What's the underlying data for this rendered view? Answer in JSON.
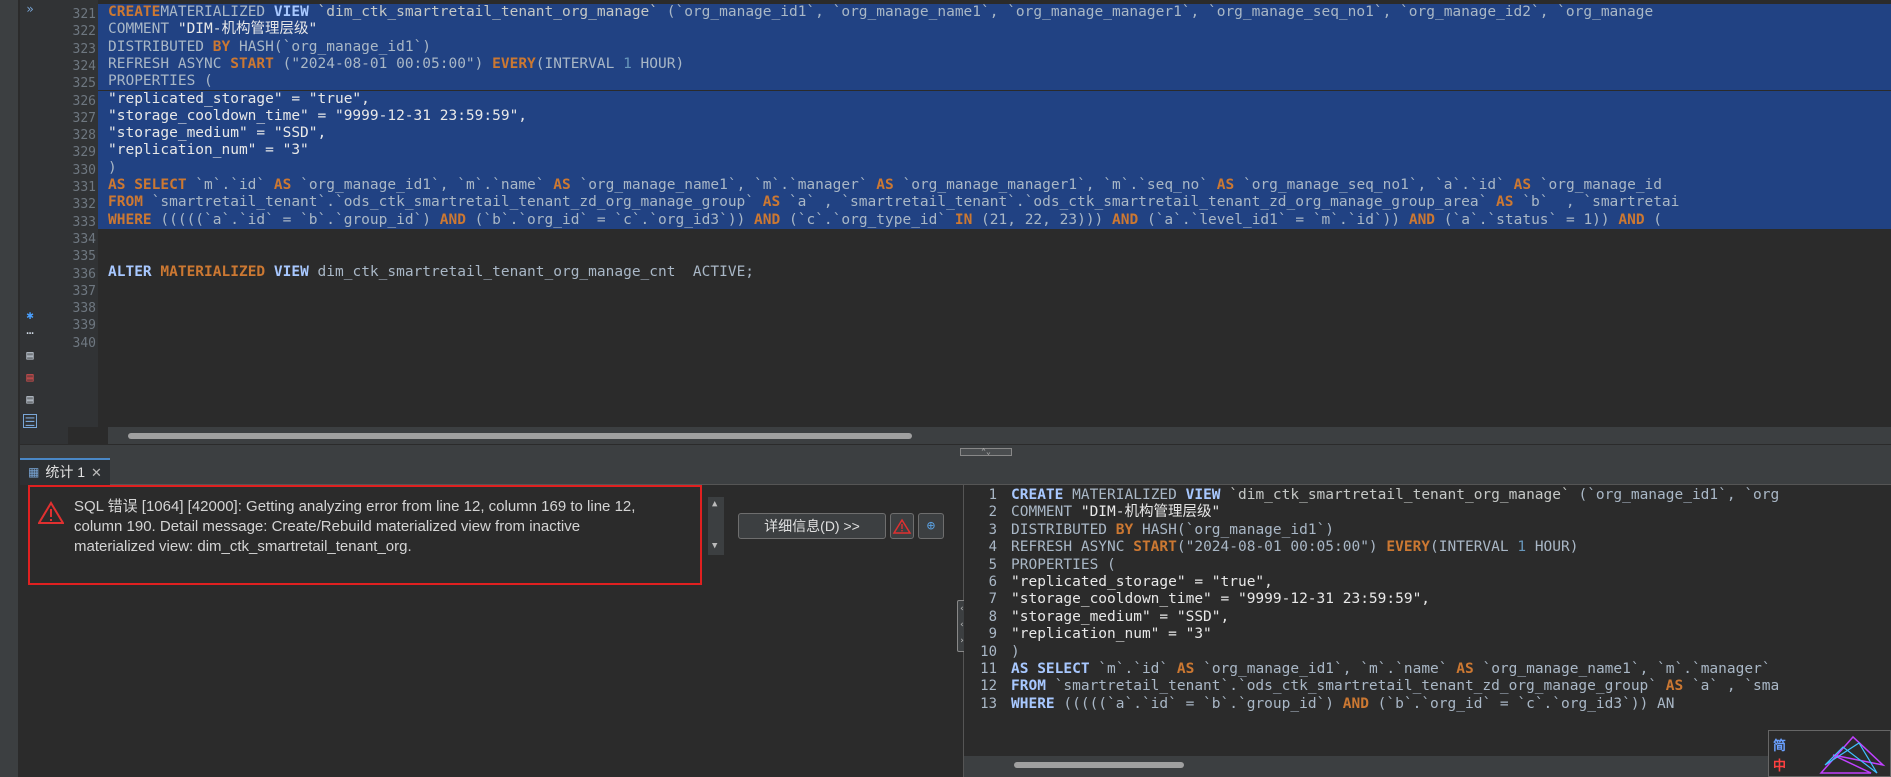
{
  "editor": {
    "line_numbers": [
      "321",
      "322",
      "323",
      "324",
      "325",
      "326",
      "327",
      "328",
      "329",
      "330",
      "331",
      "332",
      "333",
      "334",
      "335",
      "336",
      "337",
      "338",
      "339",
      "340"
    ],
    "lines": [
      {
        "parts": [
          [
            "kw",
            "CREATE"
          ],
          [
            "",
            "MATERIALIZED"
          ],
          [
            "kb",
            " VIEW"
          ],
          [
            "bt",
            " `dim_ctk_smartretail_tenant_org_manage`"
          ],
          [
            "",
            " (`org_manage_id1`, `org_manage_name1`, `org_manage_manager1`, `org_manage_seq_no1`, `org_manage_id2`, `org_manage"
          ]
        ],
        "sel": true
      },
      {
        "parts": [
          [
            "",
            "COMMENT "
          ],
          [
            "str",
            "\"DIM-机构管理层级\""
          ]
        ],
        "sel": true
      },
      {
        "parts": [
          [
            "",
            "DISTRIBUTED "
          ],
          [
            "kw",
            "BY"
          ],
          [
            "",
            " HASH(`org_manage_id1`)"
          ]
        ],
        "sel": true
      },
      {
        "parts": [
          [
            "",
            "REFRESH ASYNC "
          ],
          [
            "kw",
            "START"
          ],
          [
            "",
            " (\"2024-08-01 00:05:00\") "
          ],
          [
            "kw",
            "EVERY"
          ],
          [
            "",
            "(INTERVAL "
          ],
          [
            "num",
            "1"
          ],
          [
            "",
            " HOUR)"
          ]
        ],
        "sel": true
      },
      {
        "parts": [
          [
            "",
            "PROPERTIES ("
          ]
        ],
        "sel": true
      },
      {
        "parts": [
          [
            "str",
            "\"replicated_storage\" = \"true\","
          ]
        ],
        "sel": true
      },
      {
        "parts": [
          [
            "str",
            "\"storage_cooldown_time\" = \"9999-12-31 23:59:59\","
          ]
        ],
        "sel": true
      },
      {
        "parts": [
          [
            "str",
            "\"storage_medium\" = \"SSD\","
          ]
        ],
        "sel": true
      },
      {
        "parts": [
          [
            "str",
            "\"replication_num\" = \"3\""
          ]
        ],
        "sel": true
      },
      {
        "parts": [
          [
            "",
            ")"
          ]
        ],
        "sel": true
      },
      {
        "parts": [
          [
            "kw",
            "AS SELECT"
          ],
          [
            "",
            " `m`.`id` "
          ],
          [
            "kw",
            "AS"
          ],
          [
            "",
            " `org_manage_id1`, `m`.`name` "
          ],
          [
            "kw",
            "AS"
          ],
          [
            "",
            " `org_manage_name1`, `m`.`manager` "
          ],
          [
            "kw",
            "AS"
          ],
          [
            "",
            " `org_manage_manager1`, `m`.`seq_no` "
          ],
          [
            "kw",
            "AS"
          ],
          [
            "",
            " `org_manage_seq_no1`, `a`.`id` "
          ],
          [
            "kw",
            "AS"
          ],
          [
            "",
            " `org_manage_id"
          ]
        ],
        "sel": true
      },
      {
        "parts": [
          [
            "kw",
            "FROM"
          ],
          [
            "",
            " `smartretail_tenant`.`ods_ctk_smartretail_tenant_zd_org_manage_group` "
          ],
          [
            "kw",
            "AS"
          ],
          [
            "",
            " `a` , `smartretail_tenant`.`ods_ctk_smartretail_tenant_zd_org_manage_group_area` "
          ],
          [
            "kw",
            "AS"
          ],
          [
            "",
            " `b`  , `smartretai"
          ]
        ],
        "sel": true
      },
      {
        "parts": [
          [
            "kw",
            "WHERE"
          ],
          [
            "",
            " (((((`a`.`id` = `b`.`group_id`) "
          ],
          [
            "kw",
            "AND"
          ],
          [
            "",
            " (`b`.`org_id` = `c`.`org_id3`)) "
          ],
          [
            "kw",
            "AND"
          ],
          [
            "",
            " (`c`.`org_type_id` "
          ],
          [
            "kw",
            "IN"
          ],
          [
            "",
            " (21, 22, 23))) "
          ],
          [
            "kw",
            "AND"
          ],
          [
            "",
            " (`a`.`level_id1` = `m`.`id`)) "
          ],
          [
            "kw",
            "AND"
          ],
          [
            "",
            " (`a`.`status` = 1)) "
          ],
          [
            "kw",
            "AND"
          ],
          [
            "",
            " ("
          ]
        ],
        "sel": true
      },
      {
        "parts": [
          [
            "",
            ""
          ]
        ],
        "sel": false
      },
      {
        "parts": [
          [
            "",
            ""
          ]
        ],
        "sel": false
      },
      {
        "parts": [
          [
            "kb",
            "ALTER"
          ],
          [
            "",
            " "
          ],
          [
            "kw",
            "MATERIALIZED"
          ],
          [
            "kb",
            " VIEW"
          ],
          [
            "",
            " dim_ctk_smartretail_tenant_org_manage_cnt  ACTIVE;"
          ]
        ],
        "sel": false
      },
      {
        "parts": [
          [
            "",
            ""
          ]
        ],
        "sel": false
      },
      {
        "parts": [
          [
            "",
            ""
          ]
        ],
        "sel": false
      },
      {
        "parts": [
          [
            "",
            ""
          ]
        ],
        "sel": false
      },
      {
        "parts": [
          [
            "",
            ""
          ]
        ],
        "sel": false
      }
    ]
  },
  "result_tab": {
    "label": "统计 1",
    "close": "✕"
  },
  "error": {
    "line1": "SQL 错误 [1064] [42000]: Getting analyzing error from line 12, column 169 to line 12,",
    "line2": "column 190. Detail message: Create/Rebuild materialized view from inactive",
    "line3": "materialized view: dim_ctk_smartretail_tenant_org."
  },
  "buttons": {
    "details": "详细信息(D) >>"
  },
  "preview": {
    "line_numbers": [
      "1",
      "2",
      "3",
      "4",
      "5",
      "6",
      "7",
      "8",
      "9",
      "10",
      "11",
      "12",
      "13"
    ],
    "lines": [
      {
        "parts": [
          [
            "kb",
            "CREATE"
          ],
          [
            "",
            " MATERIALIZED "
          ],
          [
            "kb",
            "VIEW"
          ],
          [
            "bt",
            " `dim_ctk_smartretail_tenant_org_manage`"
          ],
          [
            "",
            " (`org_manage_id1`, `org"
          ]
        ]
      },
      {
        "parts": [
          [
            "",
            "COMMENT "
          ],
          [
            "str",
            "\"DIM-机构管理层级\""
          ]
        ]
      },
      {
        "parts": [
          [
            "",
            "DISTRIBUTED "
          ],
          [
            "kw",
            "BY"
          ],
          [
            "",
            " HASH(`org_manage_id1`)"
          ]
        ]
      },
      {
        "parts": [
          [
            "",
            "REFRESH ASYNC "
          ],
          [
            "kw",
            "START"
          ],
          [
            "",
            "(\"2024-08-01 00:05:00\") "
          ],
          [
            "kw",
            "EVERY"
          ],
          [
            "",
            "(INTERVAL "
          ],
          [
            "num",
            "1"
          ],
          [
            "",
            " HOUR)"
          ]
        ]
      },
      {
        "parts": [
          [
            "",
            "PROPERTIES ("
          ]
        ]
      },
      {
        "parts": [
          [
            "str",
            "\"replicated_storage\" = \"true\","
          ]
        ]
      },
      {
        "parts": [
          [
            "str",
            "\"storage_cooldown_time\" = \"9999-12-31 23:59:59\","
          ]
        ]
      },
      {
        "parts": [
          [
            "str",
            "\"storage_medium\" = \"SSD\","
          ]
        ]
      },
      {
        "parts": [
          [
            "str",
            "\"replication_num\" = \"3\""
          ]
        ]
      },
      {
        "parts": [
          [
            "",
            ")"
          ]
        ]
      },
      {
        "parts": [
          [
            "kb",
            "AS SELECT"
          ],
          [
            "",
            " `m`.`id` "
          ],
          [
            "kw",
            "AS"
          ],
          [
            "",
            " `org_manage_id1`, `m`.`name` "
          ],
          [
            "kw",
            "AS"
          ],
          [
            "",
            " `org_manage_name1`, `m`.`manager`"
          ]
        ]
      },
      {
        "parts": [
          [
            "kb",
            "FROM"
          ],
          [
            "",
            " `smartretail_tenant`.`ods_ctk_smartretail_tenant_zd_org_manage_group` "
          ],
          [
            "kw",
            "AS"
          ],
          [
            "",
            " `a` , `sma"
          ]
        ]
      },
      {
        "parts": [
          [
            "kb",
            "WHERE"
          ],
          [
            "",
            " (((((`a`.`id` = `b`.`group_id`) "
          ],
          [
            "kw",
            "AND"
          ],
          [
            "",
            " (`b`.`org_id` = `c`.`org_id3`)) AN"
          ]
        ]
      }
    ]
  },
  "ime": {
    "top": "简",
    "bottom": "中"
  },
  "colors": {
    "accent": "#4a88c7",
    "error_border": "#e02020",
    "selection": "#214283"
  }
}
